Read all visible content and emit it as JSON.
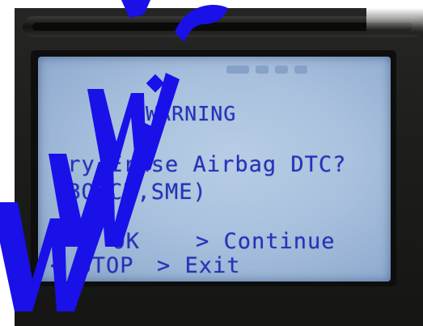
{
  "screen": {
    "title": "WARNING",
    "question_line1": "Try Erase Airbag DTC?",
    "question_line2": "(BOSCH,SME)",
    "options": {
      "ok_label": "< OK",
      "continue_label": "> Continue",
      "stop_label": "< STOP",
      "exit_label": "> Exit"
    }
  },
  "watermark": {
    "text": "WWW.O",
    "color": "#1a10e8"
  },
  "colors": {
    "lcd_background": "#a9c1de",
    "lcd_text": "#2433b8",
    "device_body": "#1d1e1c"
  }
}
